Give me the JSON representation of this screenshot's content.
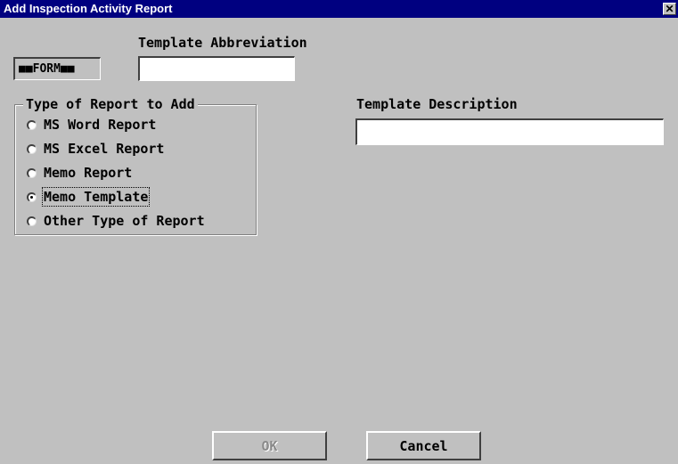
{
  "window": {
    "title": "Add Inspection Activity Report",
    "close_glyph": "✕"
  },
  "form_tag": "■■FORM■■",
  "template_abbreviation": {
    "label": "Template Abbreviation",
    "value": ""
  },
  "template_description": {
    "label": "Template Description",
    "value": ""
  },
  "report_type": {
    "label": "Type of Report to Add",
    "options": [
      {
        "label": "MS Word Report",
        "checked": false
      },
      {
        "label": "MS Excel Report",
        "checked": false
      },
      {
        "label": "Memo Report",
        "checked": false
      },
      {
        "label": "Memo Template",
        "checked": true
      },
      {
        "label": "Other Type of Report",
        "checked": false
      }
    ]
  },
  "buttons": {
    "ok": {
      "label": "OK",
      "enabled": false
    },
    "cancel": {
      "label": "Cancel",
      "enabled": true
    }
  }
}
